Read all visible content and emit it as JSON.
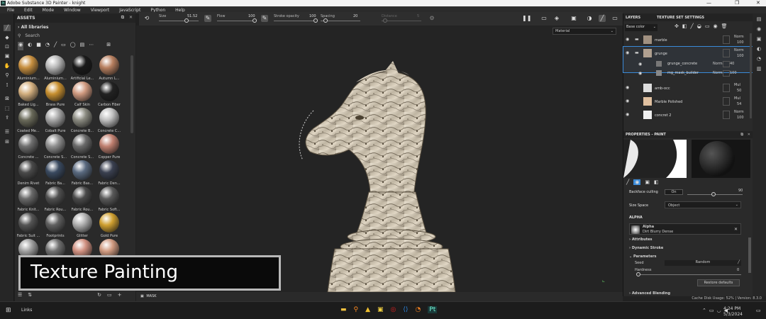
{
  "window": {
    "title": "Adobe Substance 3D Painter - knight",
    "controls": [
      "—",
      "❐",
      "✕"
    ]
  },
  "menu": [
    "File",
    "Edit",
    "Mode",
    "Window",
    "Viewport",
    "JavaScript",
    "Python",
    "Help"
  ],
  "toolbar": {
    "size_label": "Size",
    "size_value": "51.52",
    "flow_label": "Flow",
    "flow_value": "100",
    "stroke_label": "Stroke opacity",
    "stroke_value": "100",
    "spacing_label": "Spacing",
    "spacing_value": "20",
    "distance_label": "Distance",
    "distance_value": "5"
  },
  "assets": {
    "title": "ASSETS",
    "library": "All libraries",
    "search_placeholder": "Search",
    "materials": [
      {
        "name": "Aluminium...",
        "color": "#c89040"
      },
      {
        "name": "Aluminium...",
        "color": "#b8b8b8"
      },
      {
        "name": "Artificial Le...",
        "color": "#1a1a1a"
      },
      {
        "name": "Autumn L...",
        "color": "#b88060"
      },
      {
        "name": "Baked Lig...",
        "color": "#d4b080"
      },
      {
        "name": "Brass Pure",
        "color": "#c89030"
      },
      {
        "name": "Calf Skin",
        "color": "#d09a80"
      },
      {
        "name": "Carbon Fiber",
        "color": "#222222"
      },
      {
        "name": "Coated Me...",
        "color": "#6a6a5a"
      },
      {
        "name": "Cobalt Pure",
        "color": "#a8a8a8"
      },
      {
        "name": "Concrete B...",
        "color": "#8a8a80"
      },
      {
        "name": "Concrete C...",
        "color": "#c0c0c0"
      },
      {
        "name": "Concrete ...",
        "color": "#707070"
      },
      {
        "name": "Concrete S...",
        "color": "#909090"
      },
      {
        "name": "Concrete S...",
        "color": "#6a6a6a"
      },
      {
        "name": "Copper Pure",
        "color": "#c08070"
      },
      {
        "name": "Denim Rivet",
        "color": "#4a4a4a"
      },
      {
        "name": "Fabric Ba...",
        "color": "#3a4a60"
      },
      {
        "name": "Fabric Bas...",
        "color": "#5a6a80"
      },
      {
        "name": "Fabric Den...",
        "color": "#3a4050"
      },
      {
        "name": "Fabric Knit...",
        "color": "#6a6a6a"
      },
      {
        "name": "Fabric Rou...",
        "color": "#505050"
      },
      {
        "name": "Fabric Rou...",
        "color": "#4a4a4a"
      },
      {
        "name": "Fabric Soft...",
        "color": "#5a5a5a"
      },
      {
        "name": "Fabric Suit ...",
        "color": "#555555"
      },
      {
        "name": "Footprints",
        "color": "#606060"
      },
      {
        "name": "Glitter",
        "color": "#b0b0b0"
      },
      {
        "name": "Gold Pure",
        "color": "#d0a030"
      },
      {
        "name": "Gouache ...",
        "color": "#a0a0a0"
      },
      {
        "name": "Ground Gr...",
        "color": "#707070"
      },
      {
        "name": "Human Ba...",
        "color": "#d09080"
      },
      {
        "name": "Human Be...",
        "color": "#d09a80"
      },
      {
        "name": "",
        "color": "#d49880"
      },
      {
        "name": "",
        "color": "#d49a82"
      },
      {
        "name": "",
        "color": "#d09080"
      },
      {
        "name": "",
        "color": "#d49a80"
      }
    ]
  },
  "overlay_caption": "Texture Painting",
  "viewport": {
    "material_select": "Material",
    "mask_label": "MASK"
  },
  "layers": {
    "tab_layers": "LAYERS",
    "tab_texture_sets": "TEXTURE SET SETTINGS",
    "channel": "Base color",
    "items": [
      {
        "name": "marble",
        "blend": "Norm",
        "opacity": "100",
        "thumb": "#a09080"
      },
      {
        "name": "grunge",
        "blend": "Norm",
        "opacity": "100",
        "thumb": "#b0a090"
      },
      {
        "name": "grunge_concrete",
        "blend": "Norm",
        "opacity": "40",
        "thumb": "#777777"
      },
      {
        "name": "mg_mask_builder",
        "blend": "Norm",
        "opacity": "100",
        "thumb": "#888888"
      },
      {
        "name": "amb-occ",
        "blend": "Mul",
        "opacity": "50",
        "thumb": "#dddddd"
      },
      {
        "name": "Marble Polished",
        "blend": "Mul",
        "opacity": "54",
        "thumb": "#e0c0a0"
      },
      {
        "name": "concret 2",
        "blend": "Norm",
        "opacity": "100",
        "thumb": "#f0f0f0"
      }
    ]
  },
  "properties": {
    "title": "PROPERTIES - PAINT",
    "backface_label": "Backface culling",
    "backface_value": "On",
    "backface_slider": "90",
    "size_space_label": "Size Space",
    "size_space_value": "Object",
    "alpha_section": "ALPHA",
    "alpha_title": "Alpha",
    "alpha_name": "Dirt Blurry Dense",
    "attributes": "Attributes",
    "dynamic_stroke": "Dynamic Stroke",
    "parameters": "Parameters",
    "seed_label": "Seed",
    "seed_value": "Random",
    "hardness_label": "Hardness",
    "hardness_value": "0",
    "restore": "Restore defaults",
    "advanced_blending": "Advanced Blending"
  },
  "status": {
    "text": "Cache Disk Usage:  52% | Version: 8.3.0"
  },
  "taskbar": {
    "search_text": "Links",
    "time": "4:24 PM",
    "date": "5/3/2024"
  },
  "colors": {
    "accent": "#3a8ad8",
    "panel": "#2a2a2a",
    "viewport": "#242424"
  }
}
